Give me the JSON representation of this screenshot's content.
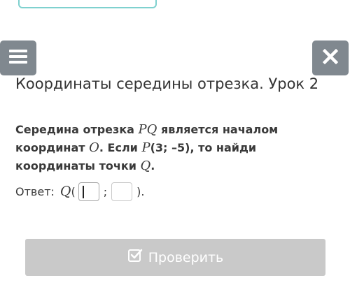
{
  "header": {
    "title": "Координаты середины отрезка. Урок 2"
  },
  "task": {
    "part1": "Середина отрезка ",
    "math1": "PQ",
    "part2": " является началом координат ",
    "math2": "O",
    "part3": ". Если ",
    "math3": "P",
    "part4": "(3; –5), то найди координаты точки ",
    "math4": "Q",
    "part5": "."
  },
  "answer": {
    "label": "Ответ: ",
    "point": "Q",
    "open": "(",
    "separator": ";",
    "close": ")."
  },
  "check_button": {
    "label": "Проверить"
  },
  "colors": {
    "icon_button_bg": "#80888f",
    "check_button_bg": "#c9c9c9",
    "top_field_border": "#7fd1cf"
  }
}
